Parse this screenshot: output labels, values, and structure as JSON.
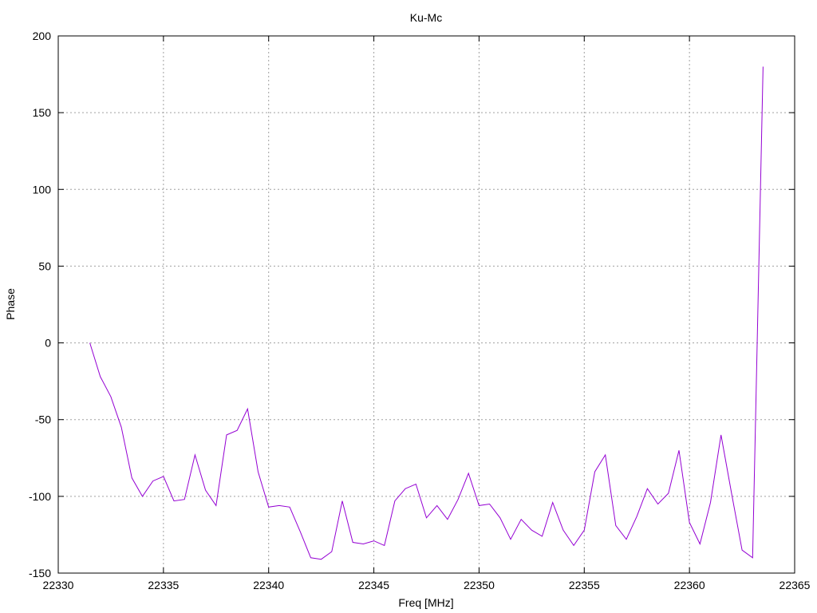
{
  "chart_data": {
    "type": "line",
    "title": "Ku-Mc",
    "xlabel": "Freq [MHz]",
    "ylabel": "Phase",
    "xlim": [
      22330,
      22365
    ],
    "ylim": [
      -150,
      200
    ],
    "xticks": [
      22330,
      22335,
      22340,
      22345,
      22350,
      22355,
      22360,
      22365
    ],
    "yticks": [
      -150,
      -100,
      -50,
      0,
      50,
      100,
      150,
      200
    ],
    "grid": true,
    "legend": "none",
    "series": [
      {
        "color": "#9400d3",
        "x": [
          22331.5,
          22332.0,
          22332.5,
          22333.0,
          22333.5,
          22334.0,
          22334.5,
          22335.0,
          22335.5,
          22336.0,
          22336.5,
          22337.0,
          22337.5,
          22338.0,
          22338.5,
          22339.0,
          22339.5,
          22340.0,
          22340.5,
          22341.0,
          22341.5,
          22342.0,
          22342.5,
          22343.0,
          22343.5,
          22344.0,
          22344.5,
          22345.0,
          22345.5,
          22346.0,
          22346.5,
          22347.0,
          22347.5,
          22348.0,
          22348.5,
          22349.0,
          22349.5,
          22350.0,
          22350.5,
          22351.0,
          22351.5,
          22352.0,
          22352.5,
          22353.0,
          22353.5,
          22354.0,
          22354.5,
          22355.0,
          22355.5,
          22356.0,
          22356.5,
          22357.0,
          22357.5,
          22358.0,
          22358.5,
          22359.0,
          22359.5,
          22360.0,
          22360.5,
          22361.0,
          22361.5,
          22362.0,
          22362.5,
          22363.0,
          22363.5
        ],
        "y": [
          0,
          -22,
          -35,
          -55,
          -88,
          -100,
          -90,
          -87,
          -103,
          -102,
          -73,
          -96,
          -106,
          -60,
          -57,
          -43,
          -84,
          -107,
          -106,
          -107,
          -123,
          -140,
          -141,
          -136,
          -103,
          -130,
          -131,
          -129,
          -132,
          -103,
          -95,
          -92,
          -114,
          -106,
          -115,
          -102,
          -85,
          -106,
          -105,
          -114,
          -128,
          -115,
          -122,
          -126,
          -104,
          -122,
          -132,
          -122,
          -84,
          -73,
          -119,
          -128,
          -113,
          -95,
          -105,
          -98,
          -70,
          -117,
          -131,
          -104,
          -60,
          -98,
          -135,
          -140,
          180
        ]
      }
    ]
  }
}
